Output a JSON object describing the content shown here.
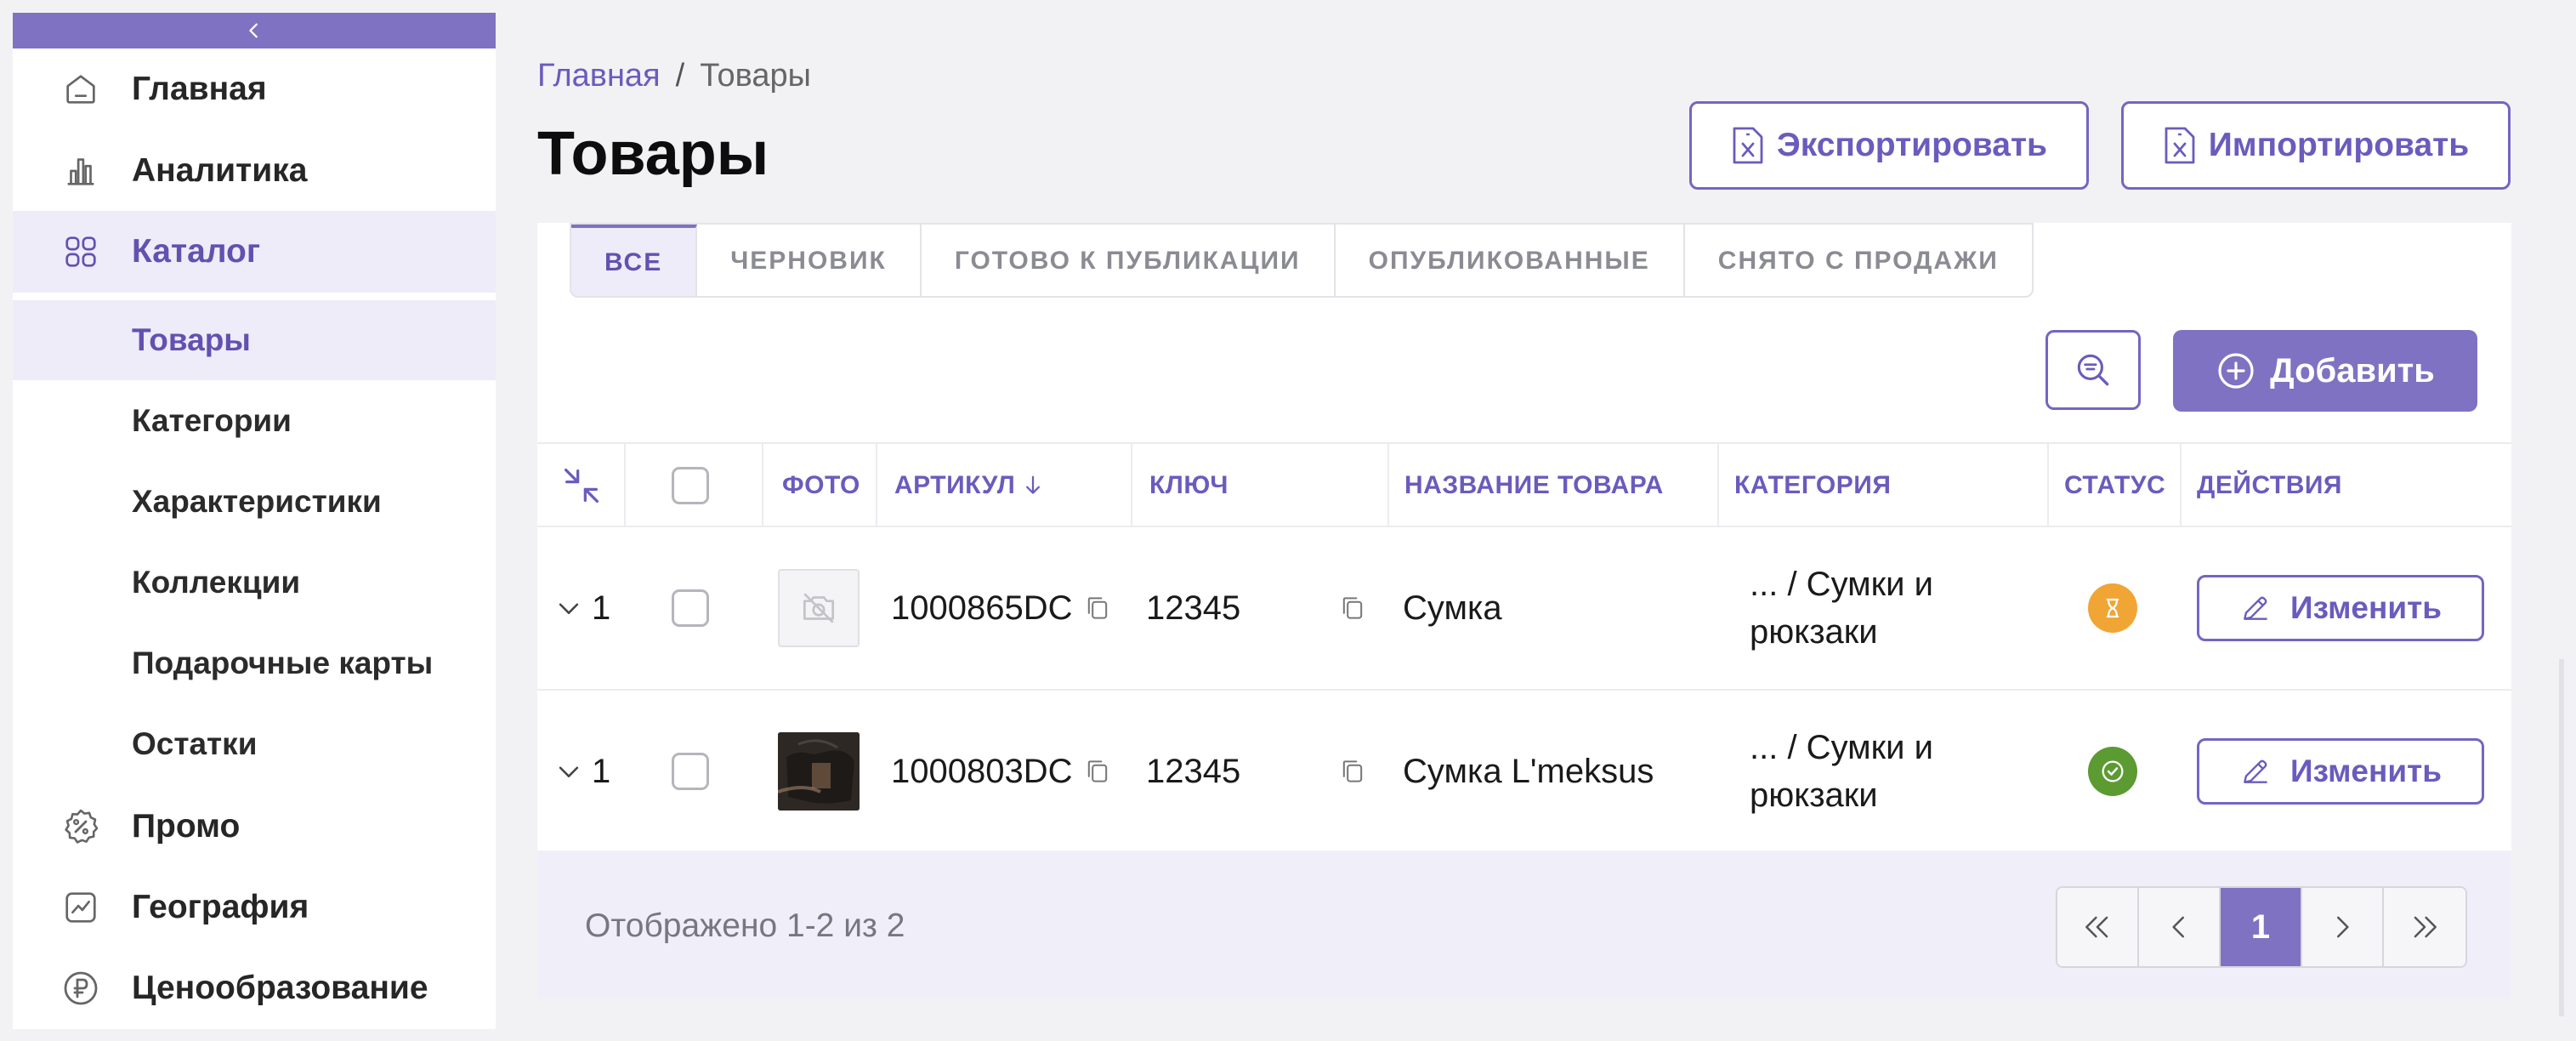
{
  "colors": {
    "accent": "#7f72c2",
    "accent_text": "#6b5bbd",
    "status_pending": "#f0a534",
    "status_ok": "#5c9a32"
  },
  "sidebar": {
    "collapse_icon": "chevron-left-icon",
    "items": [
      {
        "label": "Главная",
        "icon": "home-icon"
      },
      {
        "label": "Аналитика",
        "icon": "bar-chart-icon"
      },
      {
        "label": "Каталог",
        "icon": "grid-icon"
      },
      {
        "label": "Промо",
        "icon": "percent-badge-icon"
      },
      {
        "label": "География",
        "icon": "trend-chart-icon"
      },
      {
        "label": "Ценообразование",
        "icon": "ruble-icon"
      }
    ],
    "catalog_sub": [
      "Товары",
      "Категории",
      "Характеристики",
      "Коллекции",
      "Подарочные карты",
      "Остатки"
    ]
  },
  "breadcrumb": {
    "home": "Главная",
    "separator": "/",
    "current": "Товары"
  },
  "page_title": "Товары",
  "header": {
    "export_label": "Экспортировать",
    "import_label": "Импортировать"
  },
  "tabs": [
    "ВСЕ",
    "ЧЕРНОВИК",
    "ГОТОВО К ПУБЛИКАЦИИ",
    "ОПУБЛИКОВАННЫЕ",
    "СНЯТО С ПРОДАЖИ"
  ],
  "toolbar": {
    "add_label": "Добавить"
  },
  "table": {
    "columns": {
      "photo": "ФОТО",
      "sku": "АРТИКУЛ",
      "key": "КЛЮЧ",
      "name": "НАЗВАНИЕ ТОВАРА",
      "category": "КАТЕГОРИЯ",
      "status": "СТАТУС",
      "actions": "ДЕЙСТВИЯ"
    },
    "rows": [
      {
        "count": "1",
        "sku": "1000865DC",
        "key": "12345",
        "name": "Сумка",
        "category_l1": "... / Сумки и",
        "category_l2": "рюкзаки",
        "status": "pending",
        "edit_label": "Изменить"
      },
      {
        "count": "1",
        "sku": "1000803DC",
        "key": "12345",
        "name": "Сумка L'meksus",
        "category_l1": "... / Сумки и",
        "category_l2": "рюкзаки",
        "status": "published",
        "edit_label": "Изменить"
      }
    ]
  },
  "footer": {
    "summary": "Отображено 1-2 из 2",
    "current_page": "1"
  }
}
